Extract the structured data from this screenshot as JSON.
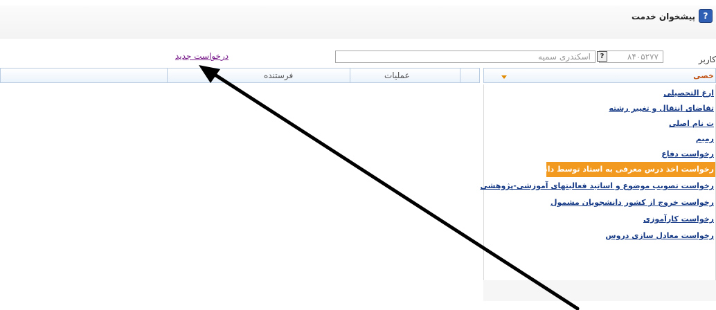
{
  "header": {
    "title": "پیشخوان خدمت",
    "help_icon_glyph": "?"
  },
  "user": {
    "label": "کاربر",
    "code": "۸۴۰۵۲۷۷",
    "lookup_glyph": "?",
    "name": "اسکندری سمیه"
  },
  "actions": {
    "new_request": "درخواست جدید"
  },
  "grid": {
    "columns": [
      "فرستنده",
      "عملیات"
    ]
  },
  "panel": {
    "title": "خصی",
    "items": [
      "ارغ التحصیلی",
      "تقاضای انتقال و تغییر رشته",
      "ت نام اصلی",
      "رمیم",
      "رخواست دفاع",
      "رخواست اخذ درس معرفی به استاد توسط دانشجو",
      "رخواست تصویب موضوع و اساتید فعالیتهای آموزشی-پژوهشی",
      "رخواست خروج از کشور دانشجویان مشمول",
      "رخواست کارآموزی",
      "رخواست معادل سازی دروس"
    ],
    "highlighted_index": 5
  },
  "colors": {
    "link": "#7a1f8c",
    "item_link": "#173b86",
    "highlight": "#f29a1f",
    "panel_title": "#c2571a",
    "help_icon": "#2f5fb5"
  },
  "icons": [
    "help-icon",
    "lookup-icon",
    "chevron-down-icon",
    "arrow-annotation"
  ]
}
